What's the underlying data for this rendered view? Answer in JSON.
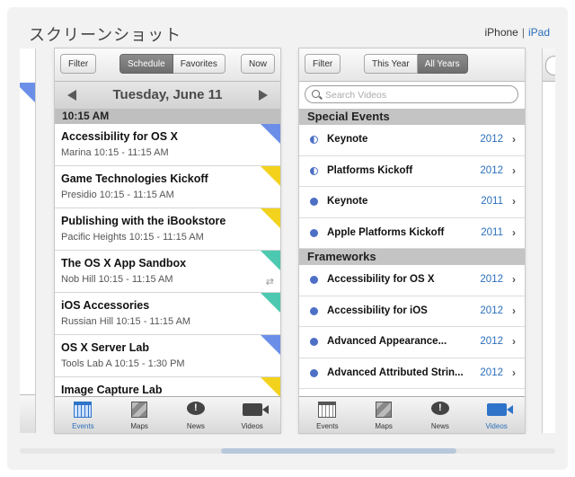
{
  "section_title": "スクリーンショット",
  "device_switch": {
    "iphone": "iPhone",
    "separator": "|",
    "ipad": "iPad"
  },
  "left_screen": {
    "toolbar": {
      "filter": "Filter",
      "segments": [
        "Schedule",
        "Favorites"
      ],
      "now": "Now"
    },
    "date": "Tuesday, June 11",
    "time_header": "10:15 AM",
    "sessions": [
      {
        "title": "Accessibility for OS X",
        "detail": "Marina 10:15 - 11:15 AM",
        "tag_color": "#6b8fe8"
      },
      {
        "title": "Game Technologies Kickoff",
        "detail": "Presidio 10:15 - 11:15 AM",
        "tag_color": "#f3d21d"
      },
      {
        "title": "Publishing with the iBookstore",
        "detail": "Pacific Heights 10:15 - 11:15 AM",
        "tag_color": "#f3d21d"
      },
      {
        "title": "The OS X App Sandbox",
        "detail": "Nob Hill 10:15 - 11:15 AM",
        "tag_color": "#4cc9b0"
      },
      {
        "title": "iOS Accessories",
        "detail": "Russian Hill 10:15 - 11:15 AM",
        "tag_color": "#4cc9b0"
      },
      {
        "title": "OS X Server Lab",
        "detail": "Tools Lab A 10:15 - 1:30 PM",
        "tag_color": "#6b8fe8"
      },
      {
        "title": "Image Capture Lab",
        "detail": "",
        "tag_color": "#f3d21d"
      }
    ]
  },
  "right_screen": {
    "toolbar": {
      "filter": "Filter",
      "segments": [
        "This Year",
        "All Years"
      ]
    },
    "search_placeholder": "Search Videos",
    "sections": [
      {
        "title": "Special Events",
        "rows": [
          {
            "name": "Keynote",
            "year": "2012",
            "icon": "half-dot"
          },
          {
            "name": "Platforms Kickoff",
            "year": "2012",
            "icon": "half-dot"
          },
          {
            "name": "Keynote",
            "year": "2011",
            "icon": "dot"
          },
          {
            "name": "Apple Platforms Kickoff",
            "year": "2011",
            "icon": "dot"
          }
        ]
      },
      {
        "title": "Frameworks",
        "rows": [
          {
            "name": "Accessibility for OS X",
            "year": "2012",
            "icon": "dot"
          },
          {
            "name": "Accessibility for iOS",
            "year": "2012",
            "icon": "dot"
          },
          {
            "name": "Advanced Appearance...",
            "year": "2012",
            "icon": "dot"
          },
          {
            "name": "Advanced Attributed Strin...",
            "year": "2012",
            "icon": "dot"
          }
        ]
      }
    ]
  },
  "tabbar": {
    "tabs": [
      {
        "label": "Events",
        "icon": "calendar-icon"
      },
      {
        "label": "Maps",
        "icon": "map-icon"
      },
      {
        "label": "News",
        "icon": "news-icon"
      },
      {
        "label": "Videos",
        "icon": "video-icon"
      }
    ],
    "left_active": 0,
    "right_active": 3
  }
}
